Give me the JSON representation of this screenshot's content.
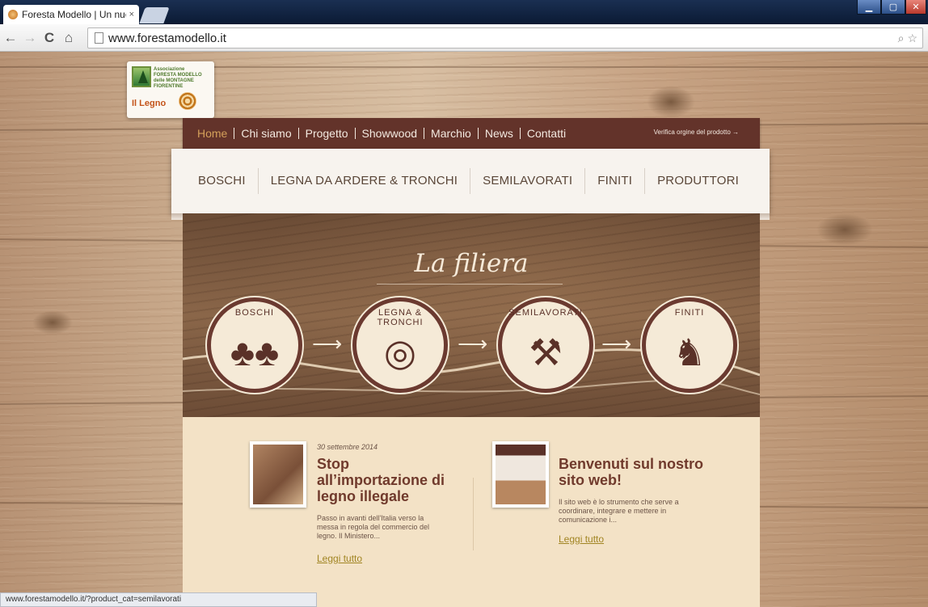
{
  "browser": {
    "tab_title": "Foresta Modello | Un nuov",
    "tab_close": "×",
    "url": "www.forestamodello.it",
    "status_url": "www.forestamodello.it/?product_cat=semilavorati"
  },
  "logo": {
    "text_line1": "Associazione",
    "text_line2": "FORESTA MODELLO",
    "text_line3": "delle MONTAGNE",
    "text_line4": "FIORENTINE",
    "tagline": "Il Legno"
  },
  "topnav": {
    "items": [
      "Home",
      "Chi siamo",
      "Progetto",
      "Showwood",
      "Marchio",
      "News",
      "Contatti"
    ],
    "verify_link": "Verifica orgine del prodotto →"
  },
  "categories": [
    "BOSCHI",
    "LEGNA DA ARDERE & TRONCHI",
    "SEMILAVORATI",
    "FINITI",
    "PRODUTTORI"
  ],
  "hero": {
    "title": "La filiera",
    "steps": [
      {
        "label": "BOSCHI",
        "icon": "trees-icon"
      },
      {
        "label": "LEGNA & TRONCHI",
        "icon": "logs-icon"
      },
      {
        "label": "SEMILAVORATI",
        "icon": "saw-icon"
      },
      {
        "label": "FINITI",
        "icon": "rocking-horse-icon"
      }
    ],
    "arrow": "⟶"
  },
  "news": [
    {
      "date": "30 settembre 2014",
      "title": "Stop all’importazione di legno illegale",
      "excerpt": "Passo in avanti dell'Italia verso la messa in regola del commercio del legno. Il Ministero...",
      "more": "Leggi tutto"
    },
    {
      "date": "",
      "title": "Benvenuti sul nostro sito web!",
      "excerpt": "Il sito web è lo strumento che serve a coordinare, integrare e mettere in comunicazione i...",
      "more": "Leggi tutto"
    }
  ],
  "colors": {
    "nav_bg": "#63332a",
    "nav_active": "#d4a05a",
    "title_brown": "#703a2c",
    "link_olive": "#a18523",
    "content_bg": "#f3e2c6"
  }
}
